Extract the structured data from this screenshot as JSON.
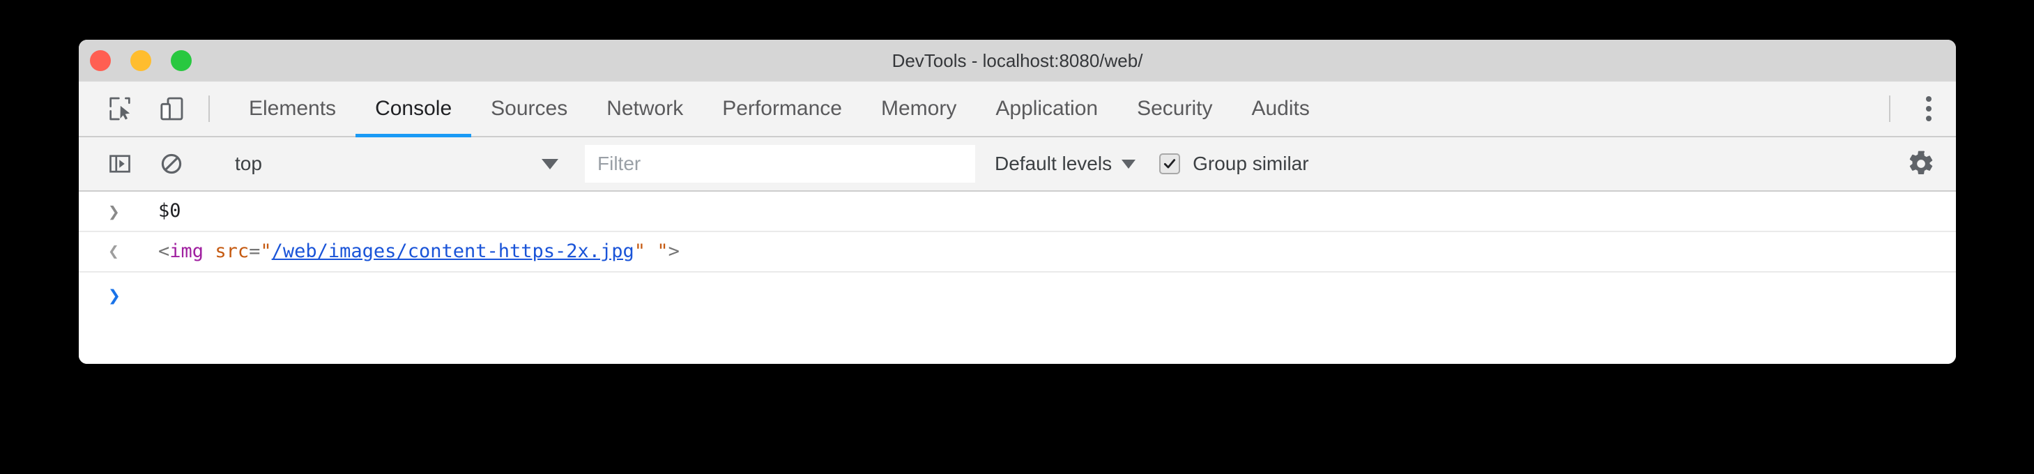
{
  "window": {
    "title": "DevTools - localhost:8080/web/",
    "traffic_lights": [
      {
        "name": "close",
        "color": "#ff5f52"
      },
      {
        "name": "minimize",
        "color": "#ffbd2e"
      },
      {
        "name": "zoom",
        "color": "#28c840"
      }
    ]
  },
  "toolbar_icons": {
    "inspect": "inspect-element-icon",
    "device": "device-toolbar-icon",
    "kebab": "more-options-icon"
  },
  "tabs": [
    {
      "label": "Elements",
      "active": false
    },
    {
      "label": "Console",
      "active": true
    },
    {
      "label": "Sources",
      "active": false
    },
    {
      "label": "Network",
      "active": false
    },
    {
      "label": "Performance",
      "active": false
    },
    {
      "label": "Memory",
      "active": false
    },
    {
      "label": "Application",
      "active": false
    },
    {
      "label": "Security",
      "active": false
    },
    {
      "label": "Audits",
      "active": false
    }
  ],
  "console_toolbar": {
    "sidebar_toggle_icon": "console-sidebar-icon",
    "clear_icon": "clear-console-icon",
    "context": "top",
    "context_caret": "▼",
    "filter_placeholder": "Filter",
    "filter_value": "",
    "levels_label": "Default levels",
    "levels_caret": "▼",
    "group_similar_label": "Group similar",
    "group_similar_checked": true,
    "checkmark": "✔",
    "settings_icon": "gear-icon"
  },
  "console": {
    "input_chevron": "❯",
    "result_chevron": "❮",
    "prompt_chevron": "❯",
    "entries": [
      {
        "type": "input",
        "expression": "$0"
      },
      {
        "type": "result",
        "tokens": [
          {
            "cls": "tok-punct",
            "text": "<"
          },
          {
            "cls": "tok-tag",
            "text": "img"
          },
          {
            "cls": "tok-punct",
            "text": " "
          },
          {
            "cls": "tok-attr",
            "text": "src"
          },
          {
            "cls": "tok-eq",
            "text": "="
          },
          {
            "cls": "tok-quote",
            "text": "\""
          },
          {
            "cls": "tok-url",
            "text": "/web/images/content-https-2x.jpg"
          },
          {
            "cls": "tok-quote",
            "text": "\""
          },
          {
            "cls": "tok-punct",
            "text": " "
          },
          {
            "cls": "tok-quote",
            "text": "\""
          },
          {
            "cls": "tok-punct",
            "text": ">"
          }
        ]
      }
    ]
  },
  "colors": {
    "accent": "#1a9af5",
    "titlebar": "#d6d6d6",
    "toolbar": "#f3f3f3",
    "body": "#ffffff",
    "page_background": "#000000"
  }
}
